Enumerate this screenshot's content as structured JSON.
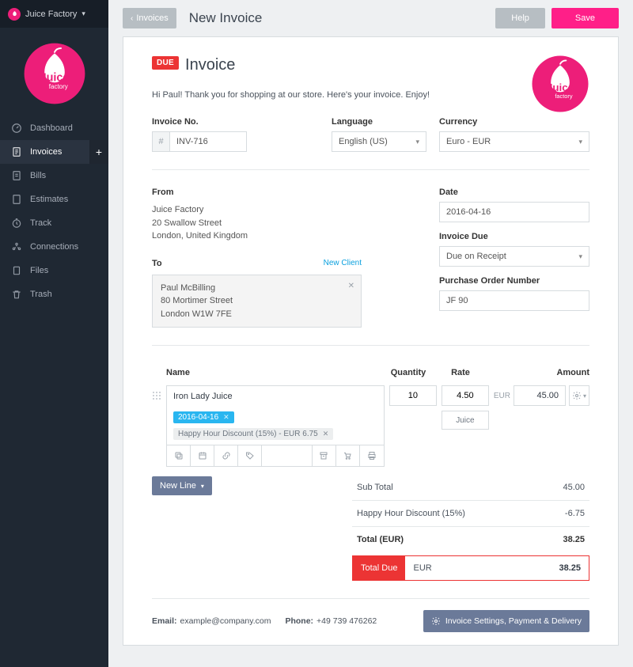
{
  "app": {
    "company": "Juice Factory"
  },
  "sidebar": {
    "items": [
      {
        "label": "Dashboard"
      },
      {
        "label": "Invoices"
      },
      {
        "label": "Bills"
      },
      {
        "label": "Estimates"
      },
      {
        "label": "Track"
      },
      {
        "label": "Connections"
      },
      {
        "label": "Files"
      },
      {
        "label": "Trash"
      }
    ]
  },
  "topbar": {
    "back": "Invoices",
    "title": "New Invoice",
    "help": "Help",
    "save": "Save"
  },
  "invoice": {
    "badge": "DUE",
    "heading": "Invoice",
    "greeting": "Hi Paul! Thank you for shopping at our store. Here's your invoice. Enjoy!",
    "number_label": "Invoice No.",
    "number_prefix": "#",
    "number": "INV-716",
    "language_label": "Language",
    "language": "English (US)",
    "currency_label": "Currency",
    "currency": "Euro - EUR",
    "from_label": "From",
    "from": {
      "name": "Juice Factory",
      "line1": "20 Swallow Street",
      "line2": "London, United Kingdom"
    },
    "to_label": "To",
    "new_client": "New Client",
    "to": {
      "name": "Paul McBilling",
      "line1": "80 Mortimer Street",
      "line2": "London W1W 7FE"
    },
    "date_label": "Date",
    "date": "2016-04-16",
    "due_label": "Invoice Due",
    "due": "Due on Receipt",
    "po_label": "Purchase Order Number",
    "po": "JF 90"
  },
  "items": {
    "headers": {
      "name": "Name",
      "qty": "Quantity",
      "rate": "Rate",
      "amount": "Amount"
    },
    "rows": [
      {
        "name": "Iron Lady Juice",
        "qty": "10",
        "rate": "4.50",
        "amount": "45.00",
        "amount_currency": "EUR",
        "unit": "Juice",
        "date_chip": "2016-04-16",
        "discount_chip": "Happy Hour Discount (15%) - EUR 6.75"
      }
    ],
    "new_line": "New Line"
  },
  "totals": {
    "subtotal_label": "Sub Total",
    "subtotal": "45.00",
    "discount_label": "Happy Hour Discount (15%)",
    "discount": "-6.75",
    "total_label": "Total (EUR)",
    "total": "38.25",
    "due_label": "Total Due",
    "due_currency": "EUR",
    "due": "38.25"
  },
  "footer": {
    "email_label": "Email:",
    "email": "example@company.com",
    "phone_label": "Phone:",
    "phone": "+49 739 476262",
    "settings": "Invoice Settings, Payment & Delivery"
  }
}
